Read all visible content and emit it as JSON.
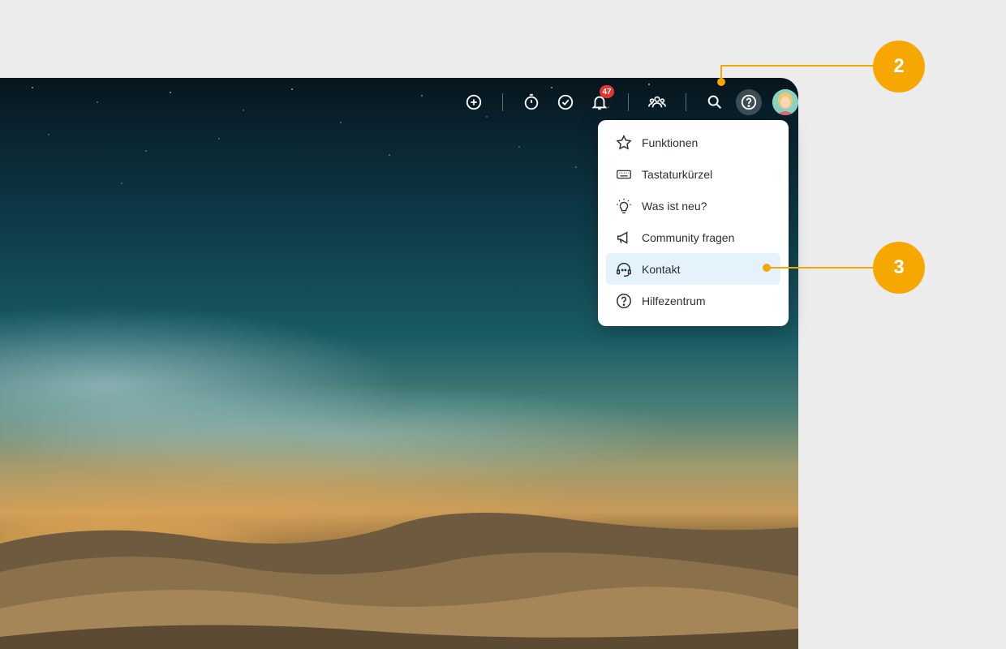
{
  "topbar": {
    "icons": [
      "add-circle-icon",
      "stopwatch-icon",
      "check-circle-icon",
      "bell-icon",
      "team-icon",
      "search-icon",
      "help-icon"
    ],
    "notifications_count": "47"
  },
  "help_menu": {
    "items": [
      {
        "label": "Funktionen",
        "icon": "star-icon"
      },
      {
        "label": "Tastaturkürzel",
        "icon": "keyboard-icon"
      },
      {
        "label": "Was ist neu?",
        "icon": "lightbulb-icon"
      },
      {
        "label": "Community fragen",
        "icon": "megaphone-icon"
      },
      {
        "label": "Kontakt",
        "icon": "headset-icon"
      },
      {
        "label": "Hilfezentrum",
        "icon": "help-circle-icon"
      }
    ],
    "highlighted_item": "Kontakt"
  },
  "callouts": {
    "help_button": "2",
    "contact_item": "3"
  },
  "colors": {
    "accent": "#f7a800",
    "badge": "#e0362f",
    "highlight": "#e3f2fb"
  }
}
